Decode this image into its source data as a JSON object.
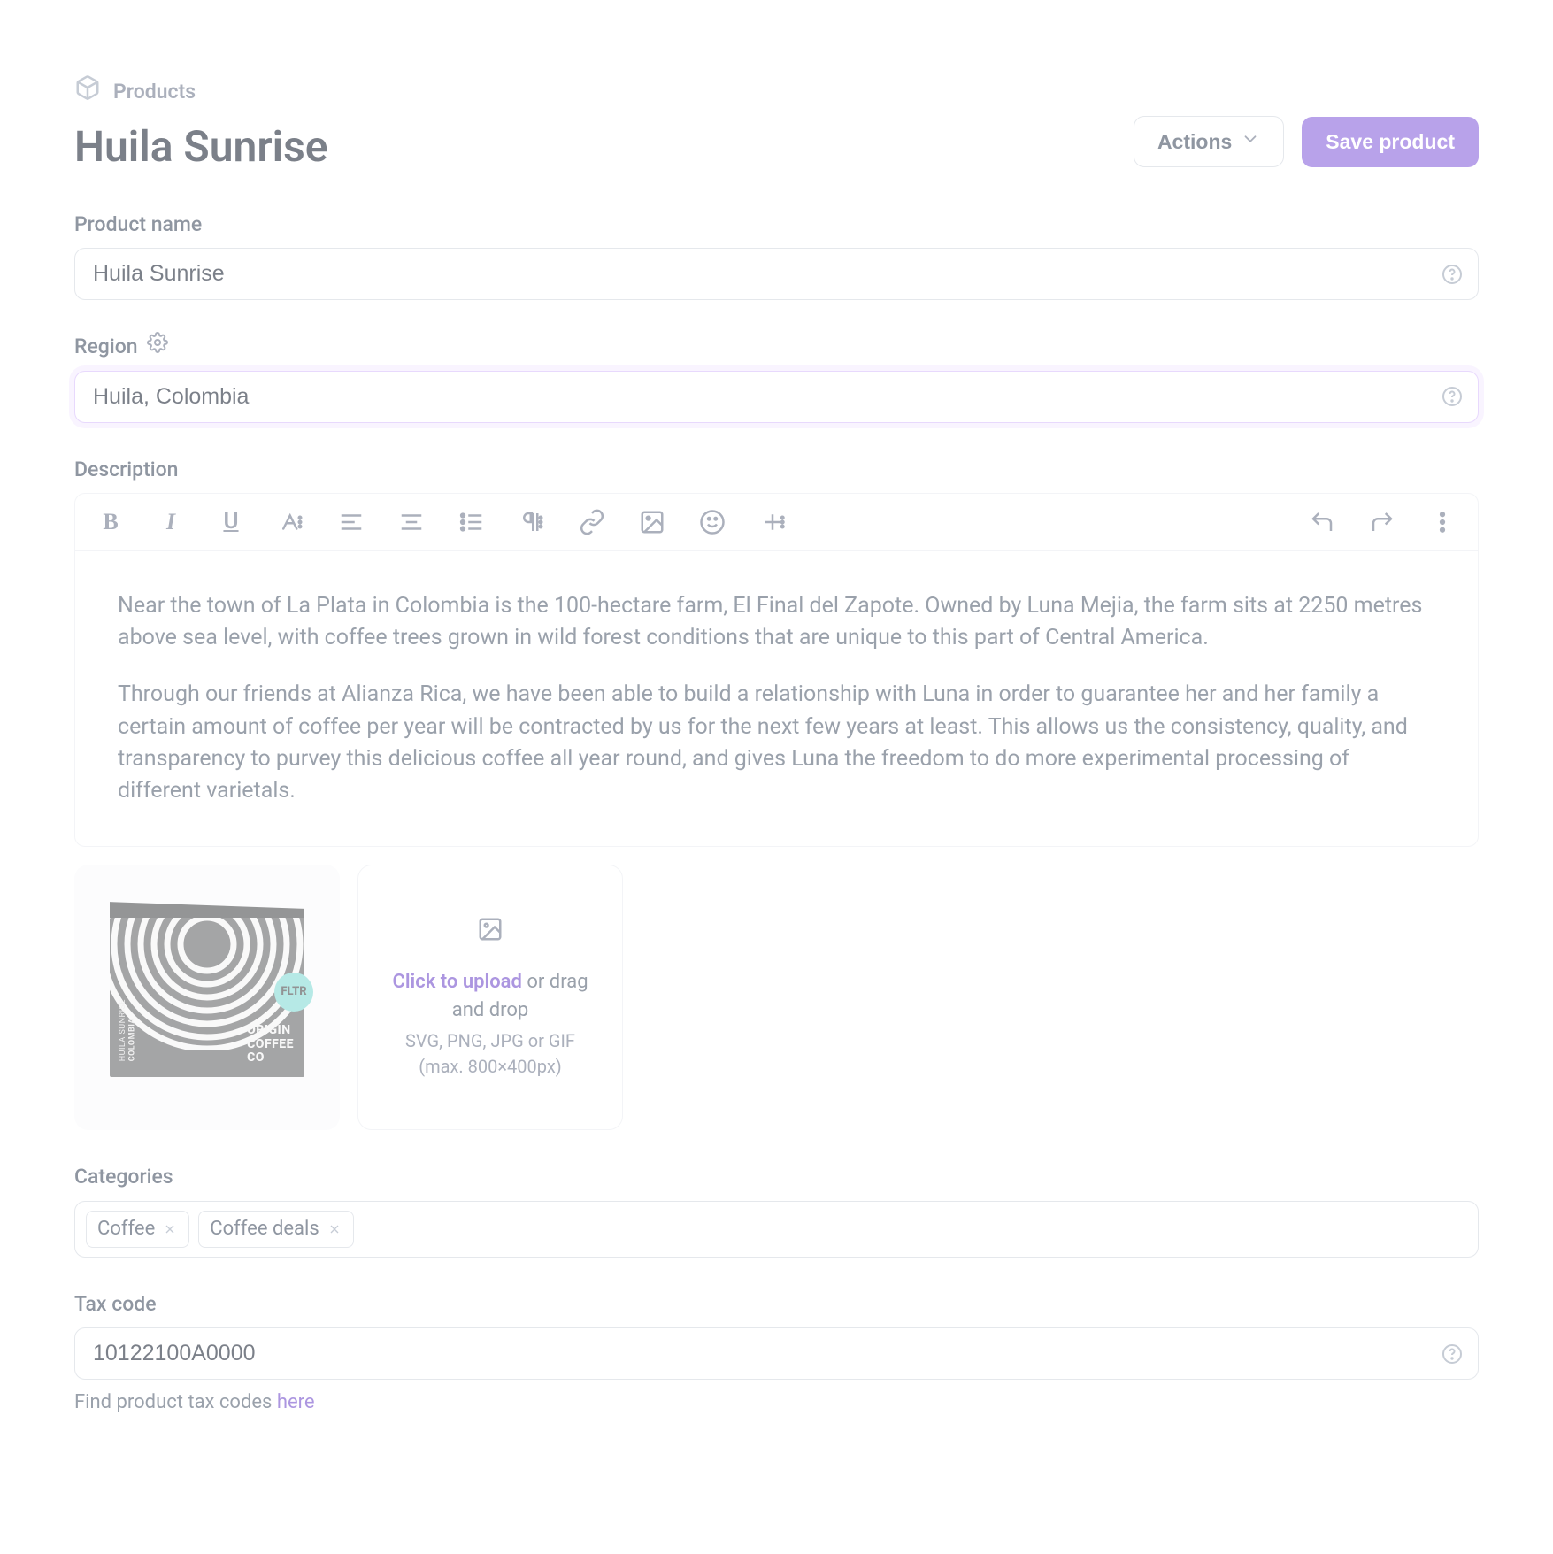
{
  "breadcrumb": {
    "label": "Products"
  },
  "page_title": "Huila Sunrise",
  "header": {
    "actions_label": "Actions",
    "save_label": "Save product"
  },
  "product_name": {
    "label": "Product name",
    "value": "Huila Sunrise"
  },
  "region": {
    "label": "Region",
    "value": "Huila, Colombia"
  },
  "description": {
    "label": "Description",
    "para1": "Near the town of La Plata in Colombia is the 100-hectare farm, El Final del Zapote. Owned by Luna Mejia, the farm sits at 2250 metres above sea level, with coffee trees grown in wild forest conditions that are unique to this part of Central America.",
    "para2": "Through our friends at Alianza Rica, we have been able to build a relationship with Luna in order to guarantee her and her family a certain amount of coffee per year will be contracted by us for the next few years at least. This allows us the consistency, quality, and transparency to purvey this delicious coffee all year round, and gives Luna the freedom to do more experimental processing of different varietals."
  },
  "uploader": {
    "click": "Click to upload",
    "drag": " or drag and drop",
    "formats": "SVG, PNG, JPG or GIF",
    "max": "(max. 800×400px)"
  },
  "product_image": {
    "badge": "FLTR",
    "side_line1": "HUILA SUNRISE",
    "side_line2": "COLOMBIA",
    "brand_line1": "ORIGIN",
    "brand_line2": "COFFEE",
    "brand_line3": "CO"
  },
  "categories": {
    "label": "Categories",
    "tags": [
      "Coffee",
      "Coffee deals"
    ]
  },
  "tax": {
    "label": "Tax code",
    "value": "10122100A0000",
    "hint_prefix": "Find product tax codes ",
    "hint_link": "here"
  }
}
